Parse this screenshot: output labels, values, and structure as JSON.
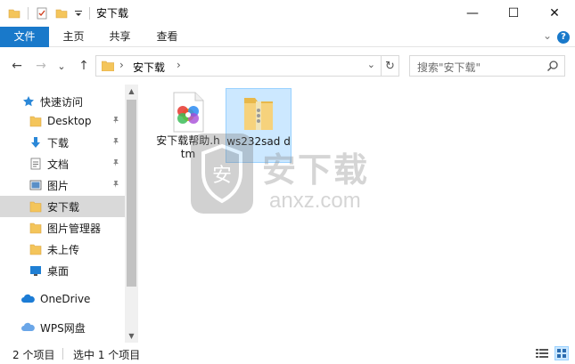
{
  "window": {
    "title": "安下载",
    "minimize_glyph": "—",
    "maximize_glyph": "☐",
    "close_glyph": "✕"
  },
  "ribbon": {
    "tabs": [
      {
        "label": "文件"
      },
      {
        "label": "主页"
      },
      {
        "label": "共享"
      },
      {
        "label": "查看"
      }
    ],
    "help_glyph": "?",
    "expand_glyph": "⌄"
  },
  "address": {
    "back_glyph": "←",
    "forward_glyph": "→",
    "recent_glyph": "⌄",
    "up_glyph": "↑",
    "sep_glyph": "›",
    "path": "安下载",
    "dropdown_glyph": "⌄",
    "refresh_glyph": "↻"
  },
  "search": {
    "placeholder": "搜索\"安下载\""
  },
  "sidebar": {
    "items": [
      {
        "label": "快速访问",
        "icon": "star-icon"
      },
      {
        "label": "Desktop",
        "icon": "folder-icon",
        "pinned": true
      },
      {
        "label": "下载",
        "icon": "download-icon",
        "pinned": true
      },
      {
        "label": "文档",
        "icon": "document-icon",
        "pinned": true
      },
      {
        "label": "图片",
        "icon": "picture-icon",
        "pinned": true
      },
      {
        "label": "安下载",
        "icon": "folder-icon",
        "selected": true
      },
      {
        "label": "图片管理器",
        "icon": "folder-icon"
      },
      {
        "label": "未上传",
        "icon": "folder-icon"
      },
      {
        "label": "桌面",
        "icon": "desktop-icon"
      },
      {
        "label": "OneDrive",
        "icon": "cloud-icon"
      },
      {
        "label": "WPS网盘",
        "icon": "cloud-icon"
      }
    ],
    "pin_glyph": "📌",
    "scroll_up_glyph": "▲",
    "scroll_down_glyph": "▼"
  },
  "files": [
    {
      "name": "安下载帮助.htm",
      "icon": "htm-file-icon",
      "selected": false
    },
    {
      "name": "ws232sad d",
      "icon": "zip-folder-icon",
      "selected": true
    }
  ],
  "watermark": {
    "title": "安下载",
    "subtitle": "anxz.com",
    "logo_char": "安"
  },
  "status": {
    "item_count": "2 个项目",
    "selected": "选中 1 个项目"
  },
  "colors": {
    "accent": "#1979ca",
    "selection_bg": "#cce8ff",
    "selection_border": "#99d1ff",
    "folder": "#f4c55b"
  }
}
